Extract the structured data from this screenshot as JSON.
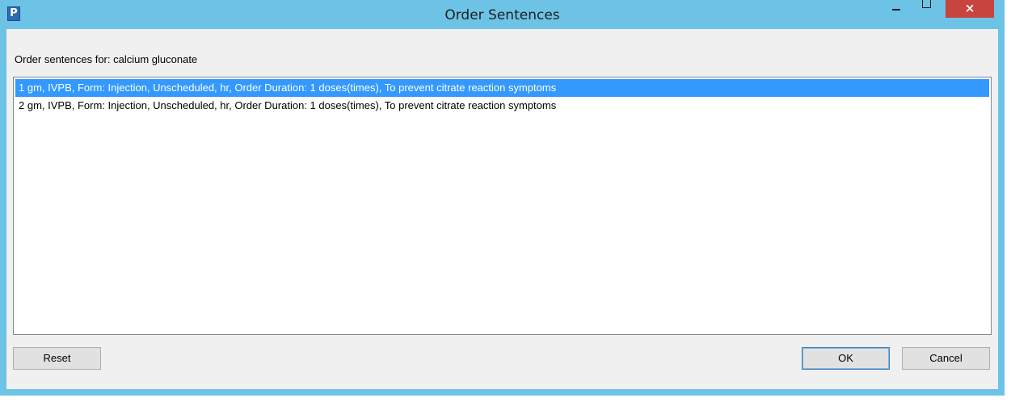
{
  "window": {
    "title": "Order Sentences",
    "app_icon_letter": "P"
  },
  "titlebar_controls": {
    "minimize": "minimize-icon",
    "maximize": "maximize-icon",
    "close_glyph": "×"
  },
  "dialog": {
    "prompt": "Order sentences for: calcium gluconate",
    "sentences": [
      {
        "text": "1 gm, IVPB, Form: Injection, Unscheduled, hr, Order Duration: 1 doses(times), To prevent citrate reaction symptoms",
        "selected": true
      },
      {
        "text": "2 gm, IVPB, Form: Injection, Unscheduled, hr, Order Duration: 1 doses(times), To prevent citrate reaction symptoms",
        "selected": false
      }
    ],
    "buttons": {
      "reset": "Reset",
      "ok": "OK",
      "cancel": "Cancel"
    }
  },
  "colors": {
    "titlebar": "#6dc3e6",
    "close_button": "#c7443f",
    "selection": "#3399ff",
    "dialog_background": "#f0f0f0"
  }
}
